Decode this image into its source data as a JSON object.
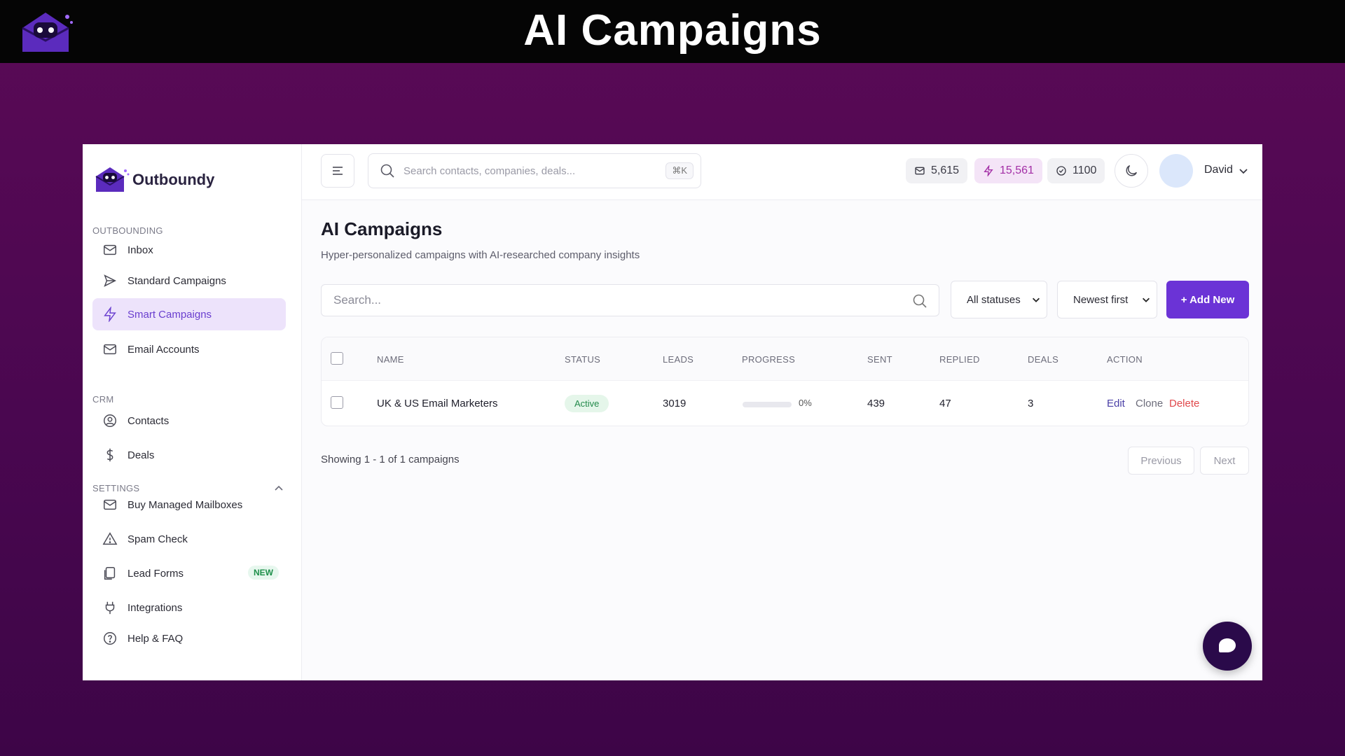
{
  "banner": {
    "title": "AI Campaigns"
  },
  "brand": {
    "name": "Outboundy"
  },
  "sidebar": {
    "sections": [
      {
        "label": "OUTBOUNDING"
      },
      {
        "label": "CRM"
      },
      {
        "label": "SETTINGS"
      }
    ],
    "items": [
      {
        "label": "Inbox",
        "icon": "mail-icon"
      },
      {
        "label": "Standard Campaigns",
        "icon": "send-icon"
      },
      {
        "label": "Smart Campaigns",
        "icon": "bolt-icon",
        "active": true
      },
      {
        "label": "Email Accounts",
        "icon": "mail-icon"
      },
      {
        "label": "Contacts",
        "icon": "user-circle-icon"
      },
      {
        "label": "Deals",
        "icon": "dollar-icon"
      },
      {
        "label": "Buy Managed Mailboxes",
        "icon": "mail-icon"
      },
      {
        "label": "Spam Check",
        "icon": "warning-icon"
      },
      {
        "label": "Lead Forms",
        "icon": "document-icon",
        "badge": "NEW"
      },
      {
        "label": "Integrations",
        "icon": "plug-icon"
      },
      {
        "label": "Help & FAQ",
        "icon": "help-icon"
      }
    ]
  },
  "topbar": {
    "search_placeholder": "Search contacts, companies, deals...",
    "shortcut": "⌘K",
    "stats": {
      "emails": "5,615",
      "credits": "15,561",
      "verified": "1100"
    },
    "user": "David"
  },
  "page": {
    "title": "AI Campaigns",
    "subtitle": "Hyper-personalized campaigns with AI-researched company insights"
  },
  "filters": {
    "search_placeholder": "Search...",
    "status": "All statuses",
    "sort": "Newest first",
    "add_button": "+ Add New"
  },
  "table": {
    "columns": [
      "NAME",
      "STATUS",
      "LEADS",
      "PROGRESS",
      "SENT",
      "REPLIED",
      "DEALS",
      "ACTION"
    ],
    "rows": [
      {
        "name": "UK & US Email Marketers",
        "status": "Active",
        "leads": "3019",
        "progress_label": "0%",
        "progress": 0,
        "sent": "439",
        "replied": "47",
        "deals": "3",
        "actions": [
          "Edit",
          "Clone",
          "Delete"
        ]
      }
    ]
  },
  "pagination": {
    "summary": "Showing 1 - 1 of 1 campaigns",
    "previous": "Previous",
    "next": "Next"
  },
  "colors": {
    "accent": "#6b33d6",
    "active_bg": "#ede3fb",
    "status_active": "#238a4b",
    "delete": "#e0484b",
    "edit": "#4a3fa6"
  }
}
